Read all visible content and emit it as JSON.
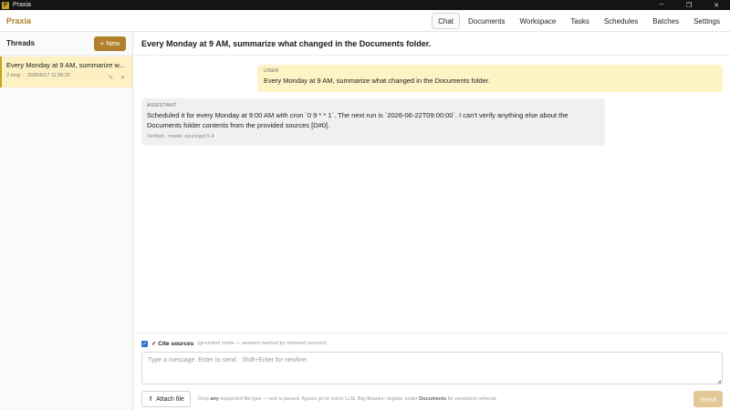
{
  "window": {
    "title": "Praxia",
    "logo_letter": "P",
    "minimize_icon": "─",
    "maximize_icon": "❐",
    "close_icon": "✕"
  },
  "header": {
    "brand": "Praxia",
    "tabs": [
      {
        "label": "Chat",
        "active": true
      },
      {
        "label": "Documents",
        "active": false
      },
      {
        "label": "Workspace",
        "active": false
      },
      {
        "label": "Tasks",
        "active": false
      },
      {
        "label": "Schedules",
        "active": false
      },
      {
        "label": "Batches",
        "active": false
      },
      {
        "label": "Settings",
        "active": false
      }
    ]
  },
  "sidebar": {
    "title": "Threads",
    "new_button": "+ New",
    "threads": [
      {
        "title": "Every Monday at 9 AM, summarize w...",
        "msg_count": "2 msg",
        "separator": "·",
        "timestamp": "2026/6/17 11:39:22",
        "rename_icon": "✎",
        "delete_icon": "✕"
      }
    ]
  },
  "conversation": {
    "title": "Every Monday at 9 AM, summarize what changed in the Documents folder.",
    "messages": [
      {
        "role": "USER",
        "text": "Every Monday at 9 AM, summarize what changed in the Documents folder."
      },
      {
        "role": "ASSISTANT",
        "text": "Scheduled it for every Monday at 9:00 AM with cron `0 9 * * 1`. The next run is `2026-06-22T09:00:00`. I can't verify anything else about the Documents folder contents from the provided sources [D#0].",
        "footer": "Verified · model: azure/gpt-5.4"
      }
    ]
  },
  "composer": {
    "cite_checked": true,
    "cite_check_icon": "✓",
    "cite_label": "✓ Cite sources",
    "cite_note": "(grounded mode — answers backed by retrieved sources)",
    "input_placeholder": "Type a message. Enter to send · Shift+Enter for newline.",
    "resize_grip": "◢",
    "attach_icon": "⇑",
    "attach_label": "Attach file",
    "attach_note_pre": "Drop ",
    "attach_note_any": "any",
    "attach_note_mid": " supported file type — text is parsed, figures go to vision LLM. Big libraries: register under ",
    "attach_note_docs": "Documents",
    "attach_note_post": " for persistent retrieval.",
    "send_label": "Send"
  },
  "colors": {
    "brand": "#b0802a",
    "user_bubble": "#fdf3c4",
    "assistant_bubble": "#f0f0f0",
    "active_thread": "#fdf0c2",
    "send_disabled": "#e3c896"
  }
}
